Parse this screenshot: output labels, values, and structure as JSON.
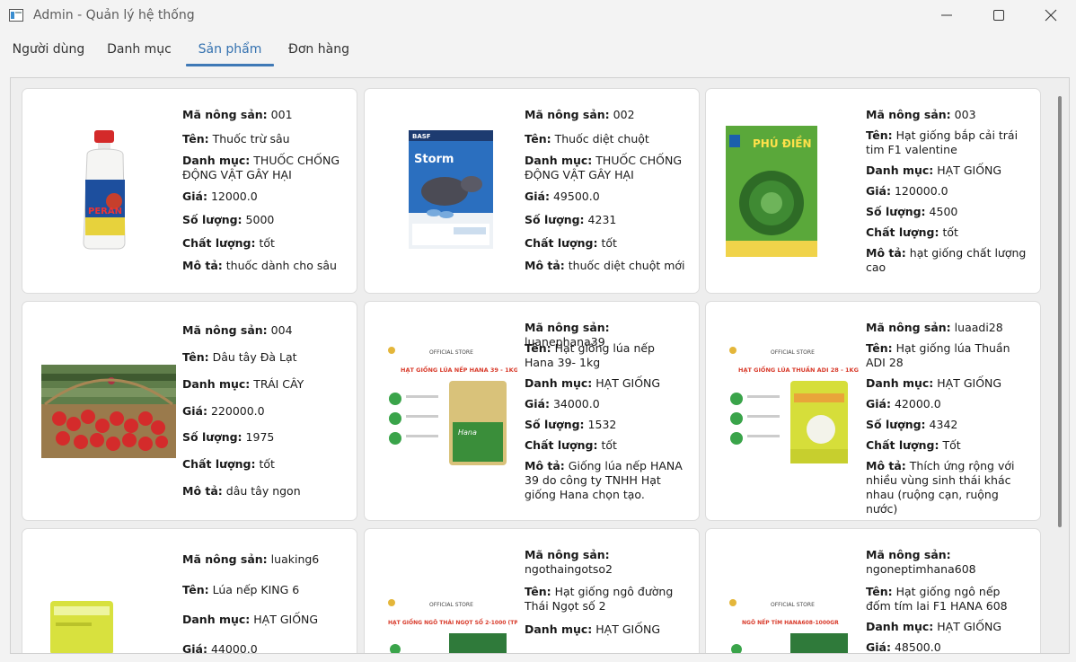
{
  "window": {
    "title": "Admin - Quản lý hệ thống"
  },
  "tabs": [
    {
      "label": "Người dùng"
    },
    {
      "label": "Danh mục"
    },
    {
      "label": "Sản phẩm",
      "active": true
    },
    {
      "label": "Đơn hàng"
    }
  ],
  "field_labels": {
    "id": "Mã nông sản:",
    "name": "Tên:",
    "category": "Danh mục:",
    "price": "Giá:",
    "quantity": "Số lượng:",
    "quality": "Chất lượng:",
    "description": "Mô tả:"
  },
  "products": [
    {
      "id": "001",
      "name": "Thuốc trừ sâu",
      "category": "THUỐC CHỐNG ĐỘNG VẬT GÂY HẠI",
      "price": "12000.0",
      "quantity": "5000",
      "quality": "tốt",
      "description": "thuốc dành cho sâu",
      "image": "pesticide-bottle",
      "image_text": "PERAN"
    },
    {
      "id": "002",
      "name": "Thuốc diệt chuột",
      "category": "THUỐC CHỐNG ĐỘNG VẬT GÂY HẠI",
      "price": "49500.0",
      "quantity": "4231",
      "quality": "tốt",
      "description": "thuốc diệt chuột mới",
      "image": "rodenticide-pack",
      "image_text": "Storm"
    },
    {
      "id": "003",
      "name": "Hạt giống bắp cải trái tim F1 valentine",
      "category": "HẠT GIỐNG",
      "price": "120000.0",
      "quantity": "4500",
      "quality": "tốt",
      "description": "hạt giống chất lượng cao",
      "image": "cabbage-seed-pack",
      "image_text": "PHÚ ĐIỀN"
    },
    {
      "id": "004",
      "name": "Dâu tây Đà Lạt",
      "category": "TRÁI CÂY",
      "price": "220000.0",
      "quantity": "1975",
      "quality": "tốt",
      "description": "dâu tây ngon",
      "image": "strawberry-photo"
    },
    {
      "id": "luanephana39",
      "name": "Hạt giống lúa nếp Hana 39- 1kg",
      "category": "HẠT GIỐNG",
      "price": "34000.0",
      "quantity": "1532",
      "quality": "tốt",
      "description": "Giống lúa nếp HANA 39 do công ty TNHH Hạt giống Hana chọn tạo.",
      "image": "rice-seed-bag",
      "image_text": "HẠT GIỐNG LÚA NẾP HANA 39 - 1KG"
    },
    {
      "id": "luaadi28",
      "name": "Hạt giống lúa Thuần ADI 28",
      "category": "HẠT GIỐNG",
      "price": "42000.0",
      "quantity": "4342",
      "quality": "Tốt",
      "description": "Thích ứng rộng với nhiều vùng sinh thái khác nhau (ruộng cạn, ruộng nước)",
      "image": "rice-seed-bag",
      "image_text": "HẠT GIỐNG LÚA THUẦN ADI 28 - 1KG"
    },
    {
      "id": "luaking6",
      "name": "Lúa nếp KING 6",
      "category": "HẠT GIỐNG",
      "price": "44000.0",
      "quantity": "",
      "quality": "",
      "description": "",
      "image": "rice-seed-bag"
    },
    {
      "id": "ngothaingotso2",
      "name": "Hạt giống ngô đường Thái Ngọt số 2",
      "category": "HẠT GIỐNG",
      "price": "",
      "quantity": "",
      "quality": "",
      "description": "",
      "image": "corn-seed-bag",
      "image_text": "HẠT GIỐNG NGÔ THÁI NGỌT SỐ 2-1000 (TP)"
    },
    {
      "id": "ngoneptimhana608",
      "name": "Hạt giống ngô nếp đốm tím lai F1 HANA 608",
      "category": "HẠT GIỐNG",
      "price": "48500.0",
      "quantity": "",
      "quality": "",
      "description": "",
      "image": "corn-seed-bag",
      "image_text": "NGÔ NẾP TÍM HANA608-1000GR"
    }
  ],
  "store_label": "OFFICIAL STORE",
  "colors": {
    "accent": "#3f79b6",
    "card_bg": "#ffffff"
  }
}
